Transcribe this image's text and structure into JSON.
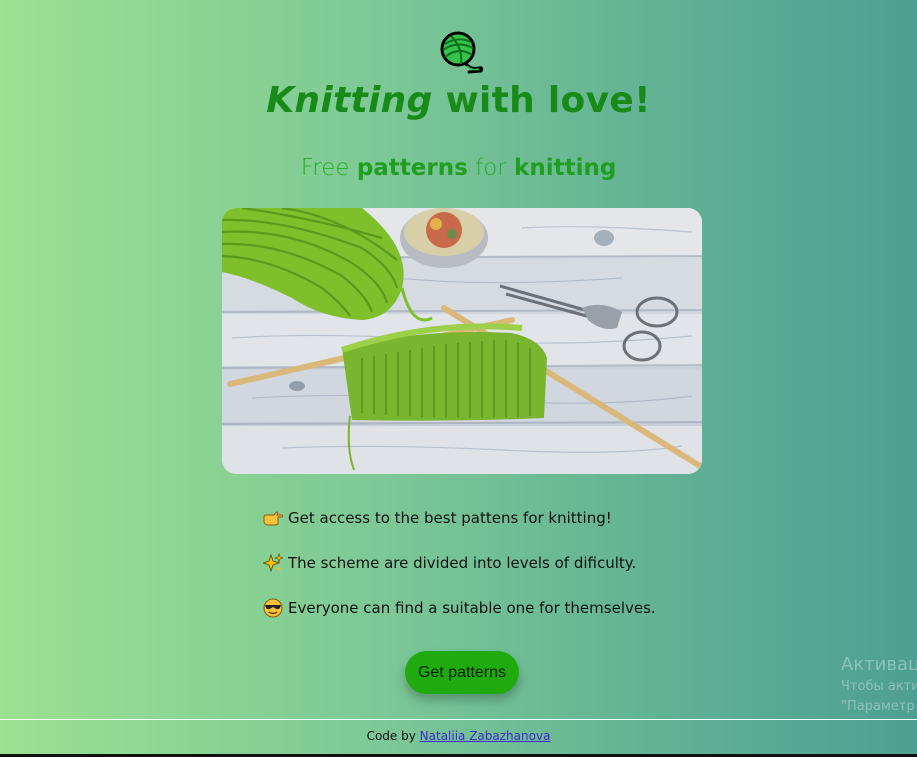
{
  "header": {
    "title_italic": "Knitting",
    "title_rest": " with love!",
    "subtitle_free": "Free ",
    "subtitle_patterns": "patterns",
    "subtitle_for": " for ",
    "subtitle_knitting": "knitting",
    "logo_icon": "yarn-ball-icon"
  },
  "hero_image": {
    "alt": "knitting needles, green yarn and scissors on wooden table"
  },
  "features": [
    {
      "icon": "pointing-hand-icon",
      "text": "Get access to the best pattens for knitting!"
    },
    {
      "icon": "sparkles-icon",
      "text": "The scheme are divided into levels of dificulty."
    },
    {
      "icon": "sunglasses-face-icon",
      "text": "Everyone can find a suitable one for themselves."
    }
  ],
  "cta": {
    "label": "Get patterns",
    "color": "#1faa0e"
  },
  "watermark": {
    "line1": "Активац",
    "line2": "Чтобы акти",
    "line3": "\"Параметр"
  },
  "footer": {
    "prefix": "Code by ",
    "author": "Nataliia Zabazhanova"
  },
  "colors": {
    "title": "#178a17",
    "subtitle": "#26ad26",
    "link": "#3d2ad0"
  }
}
